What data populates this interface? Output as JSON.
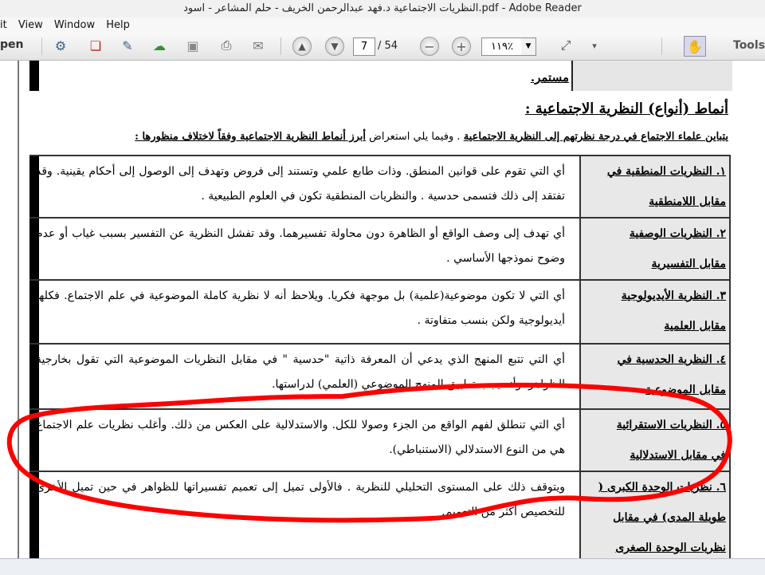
{
  "window": {
    "title": "النظريات الاجتماعية د.فهد عبدالرحمن الخريف - حلم المشاعر - اسود.pdf - Adobe Reader"
  },
  "menu": {
    "items": [
      "it",
      "View",
      "Window",
      "Help"
    ]
  },
  "toolbar": {
    "open_label": "pen",
    "current_page": "7",
    "total_pages": "/ 54",
    "zoom": "١١٩٪",
    "tools_label": "Tools"
  },
  "document": {
    "top_row_text": "مستمر.",
    "heading": "أنماط (أنواع) النظرية الاجتماعية :",
    "intro": {
      "part1": "يتباين علماء الاجتماع في درجة نظرتهم إلى النظرية الاجتماعية",
      "part2": " . وفيما يلي استعراض ",
      "part3": "أبرز أنماط النظرية الاجتماعية وفقاً لاختلاف منظورها :"
    },
    "rows": [
      {
        "num": "١.",
        "label1": "النظريات المنطقية في",
        "label2": "مقابل اللامنطقية",
        "text": "أي التي تقوم على قوانين المنطق. وذات طابع علمي وتستند إلى فروض وتهدف إلى الوصول إلى أحكام يقينية. وقد تفتقد إلى ذلك فتسمى حدسية . والنظريات المنطقية تكون في العلوم الطبيعية ."
      },
      {
        "num": "٢.",
        "label1": "النظريات الوصفية",
        "label2": "مقابل التفسيرية",
        "text": "أي تهدف إلى وصف الواقع أو الظاهرة دون محاولة تفسيرهما. وقد تفشل النظرية عن التفسير بسبب غياب أو عدم وضوح نموذجها الأساسي ."
      },
      {
        "num": "٣.",
        "label1": "النظرية الأيديولوجية",
        "label2": "مقابل العلمية",
        "text": "أي التي لا تكون موضوعية(علمية) بل موجهة فكريا. ويلاحظ أنه لا نظرية كاملة الموضوعية في علم الاجتماع. فكلها أيديولوجية ولكن بنسب متفاوتة ."
      },
      {
        "num": "٤.",
        "label1": "النظرية الحدسية في",
        "label2": "مقابل الموضوعية",
        "text": "أي التي تتبع المنهج الذي يدعي أن المعرفة ذاتية \"حدسية \" في مقابل النظريات الموضوعية التي تقول بخارجية الظواهر. وأنه يجب تطبيق المنهج الموضوعي (العلمي) لدراستها."
      },
      {
        "num": "٥.",
        "label1": "النظريات الاستقرائية",
        "label2": "في مقابل الاستدلالية",
        "text": "أي التي تنطلق لفهم الواقع من الجزء وصولا للكل. والاستدلالية على العكس من ذلك. وأغلب نظريات علم الاجتماع هي من النوع الاستدلالي (الاستنباطي)."
      },
      {
        "num": "٦.",
        "label1": "نظريات الوحدة الكبرى (",
        "label2": "طويلة المدى) في مقابل",
        "label3": "نظريات الوحدة الصغرى",
        "text": "ويتوقف ذلك على المستوى التحليلي للنظرية . فالأولى تميل إلى تعميم تفسيراتها للظواهر في حين تميل الأخرى للتخصيص أكثر من التعميم."
      }
    ]
  },
  "colors": {
    "annotation": "#ff0000",
    "label_bg": "#e8e8e8",
    "toolbar_icon": "#3b5f8a"
  }
}
